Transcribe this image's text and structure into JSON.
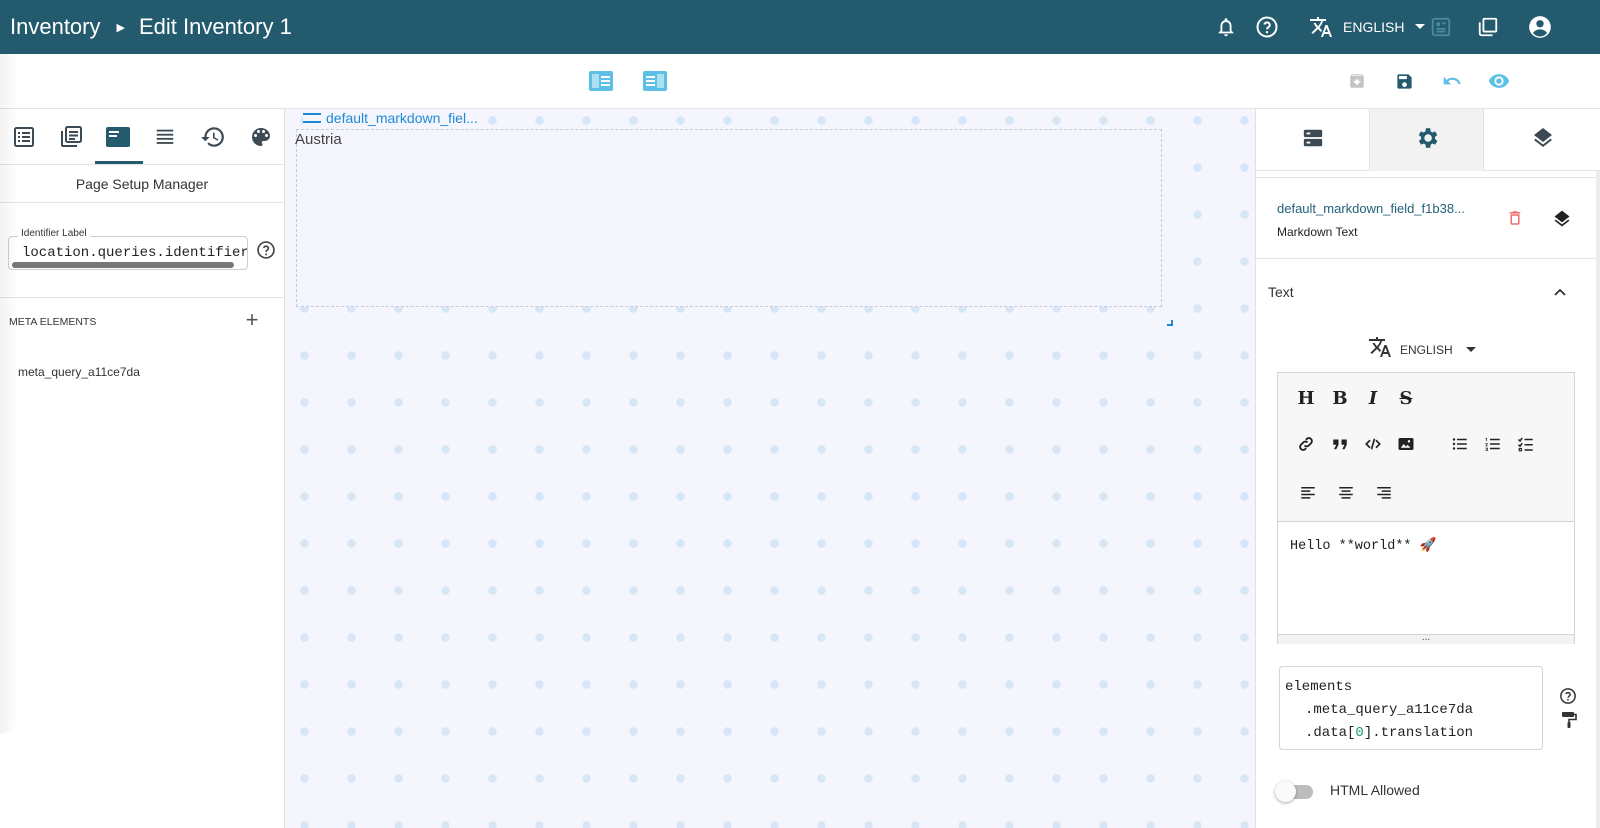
{
  "header": {
    "breadcrumb_root": "Inventory",
    "breadcrumb_page": "Edit Inventory 1",
    "language": "ENGLISH",
    "icons": [
      "bell-icon",
      "help-icon",
      "translate-icon",
      "dropdown-icon",
      "report-icon",
      "multiselect-icon",
      "account-icon"
    ]
  },
  "toolbar": {
    "icons": [
      "toggle-left-panel-icon",
      "toggle-right-panel-icon",
      "archive-icon",
      "save-icon",
      "undo-icon",
      "preview-icon"
    ]
  },
  "left_panel": {
    "tabs": [
      "list-icon",
      "library-icon",
      "page-setup-icon",
      "lines-icon",
      "history-icon",
      "palette-icon"
    ],
    "active_tab": "page-setup-icon",
    "title": "Page Setup Manager",
    "identifier_label": "Identifier Label",
    "identifier_value": "location.queries.identifier",
    "meta_title": "META ELEMENTS",
    "meta_items": [
      "meta_query_a11ce7da"
    ]
  },
  "canvas": {
    "element_tag": "default_markdown_fiel...",
    "element_text": "Austria"
  },
  "right_panel": {
    "tabs": [
      "data-icon",
      "settings-icon",
      "layers-icon"
    ],
    "active_tab": "settings-icon",
    "element_name": "default_markdown_field_f1b38...",
    "element_type": "Markdown Text",
    "section_title": "Text",
    "language": "ENGLISH",
    "editor_buttons": {
      "heading": "H",
      "bold": "B",
      "italic": "I",
      "strikethrough": "S"
    },
    "editor_content": "Hello **world** 🚀",
    "editor_grip": "...",
    "expression": {
      "line1": "elements",
      "line2": ".meta_query_a11ce7da",
      "line3_prefix": ".data[",
      "line3_index": "0",
      "line3_suffix": "].translation"
    },
    "html_allowed_label": "HTML Allowed",
    "html_allowed": false
  },
  "colors": {
    "header_bg": "#235a6e",
    "accent_blue": "#1f8ad2",
    "toolbar_icon": "#5bbfe6",
    "delete_red": "#f06b6b"
  }
}
